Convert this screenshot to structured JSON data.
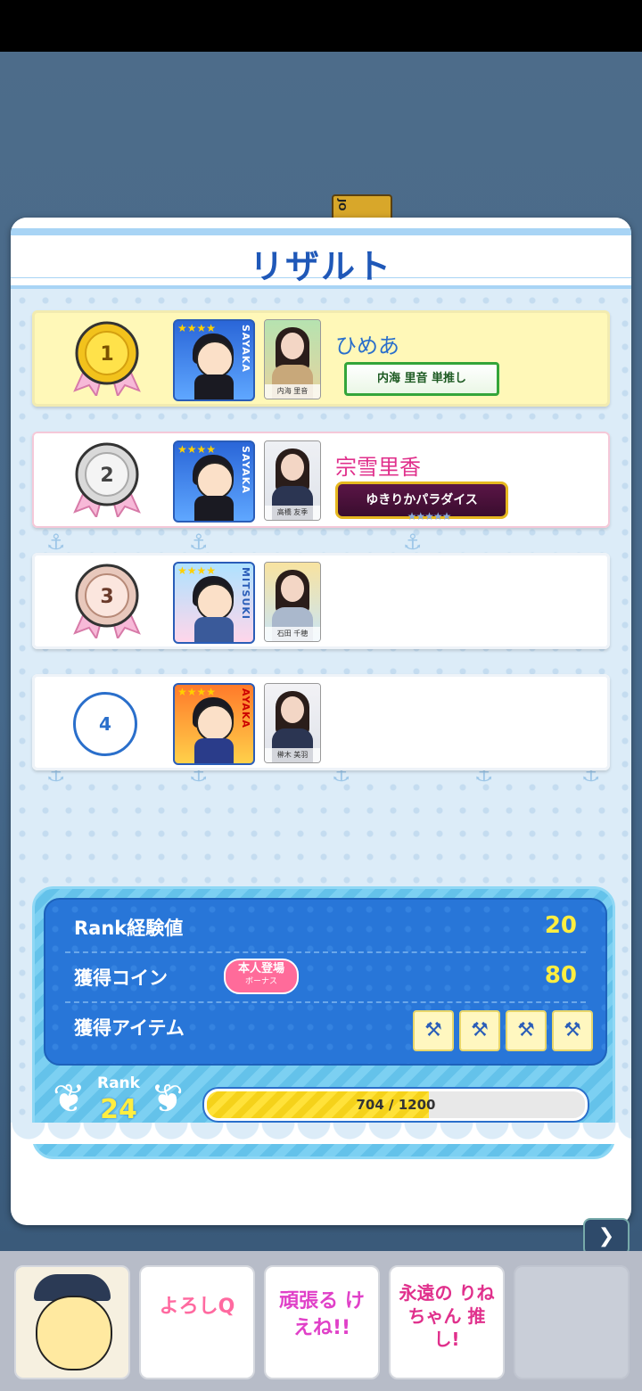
{
  "background_card": {
    "label": "JO"
  },
  "result": {
    "title": "リザルト",
    "rows": [
      {
        "rank": "1",
        "avatar_tag": "SAYAKA",
        "photo_caption": "内海 里音",
        "name": "ひめあ",
        "badge": "内海 里音 単推し"
      },
      {
        "rank": "2",
        "avatar_tag": "SAYAKA",
        "photo_caption": "高橋 友季",
        "name": "宗雪里香",
        "badge": "ゆきりかパラダイス",
        "badge_stars": "★★★★★"
      },
      {
        "rank": "3",
        "avatar_tag": "MITSUKI",
        "photo_caption": "石田 千穂",
        "name": ""
      },
      {
        "rank": "4",
        "avatar_tag": "AYAKA",
        "photo_caption": "榊木 美羽",
        "name": ""
      }
    ]
  },
  "rewards": {
    "rank_exp_label": "Rank経験値",
    "rank_exp_value": "20",
    "coins_label": "獲得コイン",
    "coins_value": "80",
    "bonus_line1": "本人登場",
    "bonus_line2": "ボーナス",
    "items_label": "獲得アイテム",
    "items": [
      "hammer-icon",
      "hammer-icon",
      "hammer-icon",
      "hammer-icon"
    ],
    "rank_label": "Rank",
    "rank_value": "24",
    "progress_text": "704 / 1200",
    "progress_fraction": 0.5867
  },
  "bottom_stamps": [
    {
      "text": ""
    },
    {
      "text": "よろしQ"
    },
    {
      "text": "頑張る けえね!!"
    },
    {
      "text": "永遠の りねちゃん 推し!"
    },
    {
      "text": ""
    }
  ],
  "colors": {
    "accent": "#2876d8",
    "gold": "#ffee40",
    "pink": "#e0308c",
    "name_blue": "#2a6fcb"
  }
}
